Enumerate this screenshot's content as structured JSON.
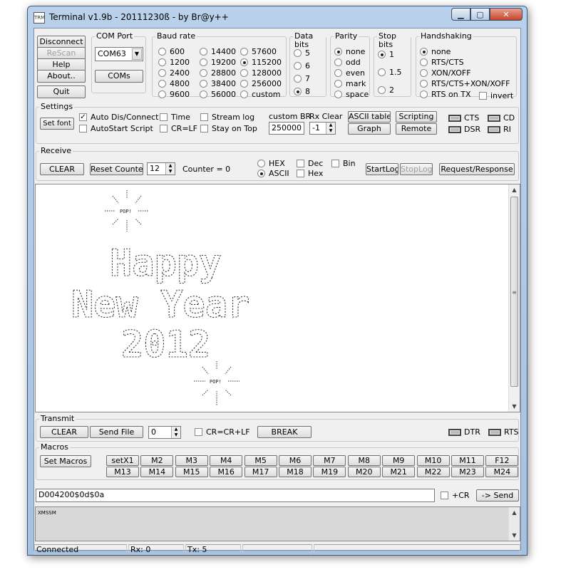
{
  "window": {
    "title": "Terminal v1.9b - 20111230ß - by Br@y++",
    "icon_text": "TRM"
  },
  "icons": {
    "minimize": "minimize-icon",
    "maximize": "maximize-icon",
    "close": "close-icon",
    "dropdown": "chevron-down-icon",
    "spin": "spin-arrows-icon"
  },
  "top_buttons": {
    "disconnect": "Disconnect",
    "rescan": "ReScan",
    "help": "Help",
    "about": "About..",
    "quit": "Quit"
  },
  "com_port": {
    "label": "COM Port",
    "value": "COM63",
    "coms_button": "COMs"
  },
  "baud_rate": {
    "label": "Baud rate",
    "options": [
      "600",
      "1200",
      "2400",
      "4800",
      "9600",
      "14400",
      "19200",
      "28800",
      "38400",
      "56000",
      "57600",
      "115200",
      "128000",
      "256000",
      "custom"
    ],
    "selected": "115200"
  },
  "data_bits": {
    "label": "Data bits",
    "options": [
      "5",
      "6",
      "7",
      "8"
    ],
    "selected": "8"
  },
  "parity": {
    "label": "Parity",
    "options": [
      "none",
      "odd",
      "even",
      "mark",
      "space"
    ],
    "selected": "none"
  },
  "stop_bits": {
    "label": "Stop bits",
    "options": [
      "1",
      "1.5",
      "2"
    ],
    "selected": "1"
  },
  "handshaking": {
    "label": "Handshaking",
    "options": [
      "none",
      "RTS/CTS",
      "XON/XOFF",
      "RTS/CTS+XON/XOFF",
      "RTS on TX"
    ],
    "selected": "none",
    "invert_label": "invert"
  },
  "settings": {
    "label": "Settings",
    "set_font": "Set font",
    "auto_dis_connect": "Auto Dis/Connect",
    "autostart_script": "AutoStart Script",
    "time": "Time",
    "cr_lf": "CR=LF",
    "stream_log": "Stream log",
    "stay_on_top": "Stay on Top",
    "custom_br_label": "custom BR",
    "custom_br_value": "250000",
    "rx_clear_label": "Rx Clear",
    "rx_clear_value": "-1",
    "ascii_table": "ASCII table",
    "graph": "Graph",
    "scripting": "Scripting",
    "remote": "Remote",
    "leds": [
      "CTS",
      "CD",
      "DSR",
      "RI"
    ]
  },
  "receive": {
    "label": "Receive",
    "clear": "CLEAR",
    "reset_counter": "Reset Counter",
    "counter_spin": "12",
    "counter_label": "Counter = 0",
    "hex": "HEX",
    "ascii": "ASCII",
    "dec": "Dec",
    "hex_chk": "Hex",
    "bin": "Bin",
    "start_log": "StartLog",
    "stop_log": "StopLog",
    "request_response": "Request/Response"
  },
  "receive_text": {
    "pop": "POP!",
    "line1": "Happy",
    "line2": "New Year",
    "line3": "2012"
  },
  "transmit": {
    "label": "Transmit",
    "clear": "CLEAR",
    "send_file": "Send File",
    "spin_value": "0",
    "cr_option": "CR=CR+LF",
    "break": "BREAK",
    "leds": [
      "DTR",
      "RTS"
    ]
  },
  "macros": {
    "label": "Macros",
    "set_macros": "Set Macros",
    "row1": [
      "setX1",
      "M2",
      "M3",
      "M4",
      "M5",
      "M6",
      "M7",
      "M8",
      "M9",
      "M10",
      "M11",
      "F12"
    ],
    "row2": [
      "M13",
      "M14",
      "M15",
      "M16",
      "M17",
      "M18",
      "M19",
      "M20",
      "M21",
      "M22",
      "M23",
      "M24"
    ]
  },
  "send": {
    "input_value": "D004200$0d$0a",
    "plus_cr": "+CR",
    "send_button": "-> Send"
  },
  "transmit_log": "XMSSM",
  "status": {
    "connection": "Connected",
    "rx": "Rx: 0",
    "tx": "Tx: 5"
  }
}
